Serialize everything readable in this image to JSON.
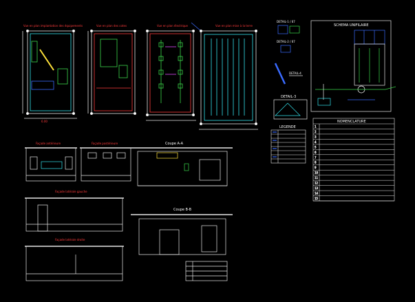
{
  "view_titles": {
    "plan_implantation": "Vue en plan implantation des équipements",
    "plan_cotes": "Vue en plan des cotes",
    "plan_electrique": "Vue en plan électrique",
    "plan_mise_terre": "Vue en plan mise à la terre",
    "detail_1": "DETAIL-1 / 67",
    "detail_2": "DETAIL-2 / 67",
    "detail_4": "DETAIL-4",
    "detail_3": "DETAIL-3",
    "schema": "SCHEMA UNIFILAIRE",
    "legende": "LEGENDE",
    "facade_anterieure": "Façade antérieure",
    "facade_posterieure": "Façade postérieure",
    "facade_laterale_gauche": "Façade latérale gauche",
    "facade_laterale_droite": "Façade latérale droite",
    "coupe_aa": "Coupe A-A",
    "coupe_bb": "Coupe B-B"
  },
  "nomenclature": {
    "title": "NOMENCLATURE",
    "rows": [
      "1",
      "2",
      "3",
      "4",
      "5",
      "6",
      "7",
      "8",
      "9",
      "10",
      "11",
      "12",
      "13",
      "14",
      "15"
    ]
  },
  "colors": {
    "line_white": "#e8e8e8",
    "line_red": "#ff3b3b",
    "line_yellow": "#ffe23b",
    "line_cyan": "#35e6f0",
    "line_blue": "#3a6bff",
    "line_green": "#3bd84a",
    "line_magenta": "#e04cff"
  }
}
